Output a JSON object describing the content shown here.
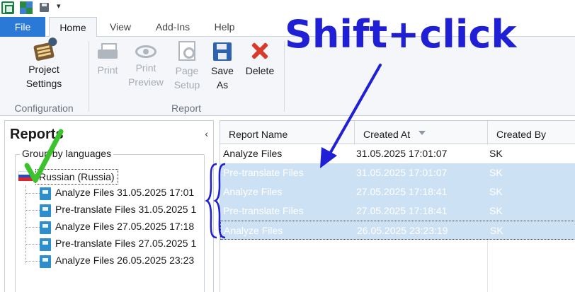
{
  "qat": {
    "icons": [
      "app-icon",
      "puzzle-icon",
      "save-icon"
    ],
    "more": "▾"
  },
  "tabs": {
    "file": "File",
    "home": "Home",
    "view": "View",
    "addins": "Add-Ins",
    "help": "Help"
  },
  "ribbon": {
    "configuration": {
      "label": "Configuration",
      "project_settings": "Project\nSettings"
    },
    "report": {
      "label": "Report",
      "print": "Print",
      "print_preview": "Print\nPreview",
      "page_setup": "Page\nSetup",
      "save_as": "Save\nAs",
      "delete": "Delete"
    }
  },
  "annotation": {
    "text": "Shift+click",
    "color": "#1f1fd6"
  },
  "reports_panel": {
    "title": "Reports",
    "collapse": "‹",
    "groupbox_label": "Group by languages",
    "language": "Russian (Russia)",
    "items": [
      "Analyze Files 31.05.2025 17:01",
      "Pre-translate Files 31.05.2025 1",
      "Analyze Files 27.05.2025 17:18",
      "Pre-translate Files 27.05.2025 1",
      "Analyze Files 26.05.2025 23:23"
    ]
  },
  "grid": {
    "columns": [
      "Report Name",
      "Created At",
      "Created By"
    ],
    "rows": [
      {
        "name": "Analyze Files",
        "created_at": "31.05.2025 17:01:07",
        "created_by": "SK",
        "selected": false
      },
      {
        "name": "Pre-translate Files",
        "created_at": "31.05.2025 17:01:07",
        "created_by": "SK",
        "selected": true
      },
      {
        "name": "Analyze Files",
        "created_at": "27.05.2025 17:18:41",
        "created_by": "SK",
        "selected": true
      },
      {
        "name": "Pre-translate Files",
        "created_at": "27.05.2025 17:18:41",
        "created_by": "SK",
        "selected": true
      },
      {
        "name": "Analyze Files",
        "created_at": "26.05.2025 23:23:19",
        "created_by": "SK",
        "selected": true
      }
    ]
  },
  "colors": {
    "file_tab": "#2b79d6",
    "selection": "#cde1f4",
    "annotation_blue": "#1f1fd6",
    "checkmark_green": "#3cc22c"
  }
}
